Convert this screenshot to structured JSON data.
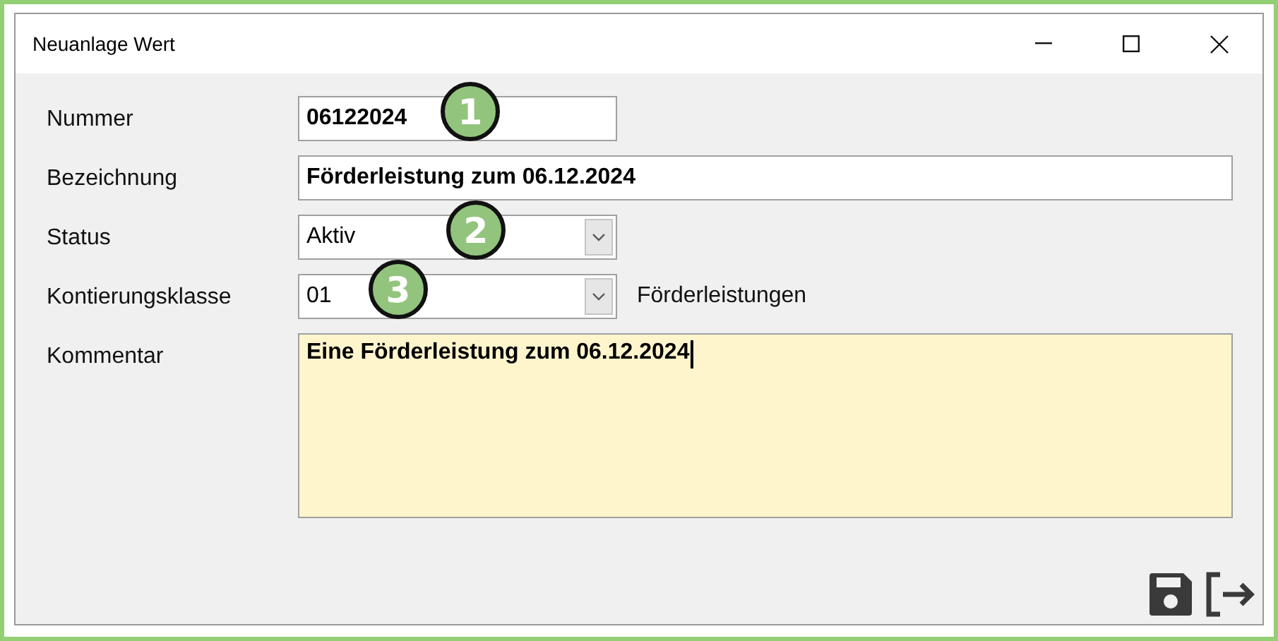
{
  "window": {
    "title": "Neuanlage Wert"
  },
  "fields": [
    {
      "kind": "text",
      "label": "Nummer",
      "value": "06122024",
      "badge": "1",
      "wide": false
    },
    {
      "kind": "text",
      "label": "Bezeichnung",
      "value": "Förderleistung zum 06.12.2024",
      "wide": true
    },
    {
      "kind": "combo",
      "label": "Status",
      "value": "Aktiv",
      "badge": "2"
    },
    {
      "kind": "combo",
      "label": "Kontierungsklasse",
      "value": "01",
      "badge": "3",
      "note": "Förderleistungen"
    },
    {
      "kind": "memo",
      "label": "Kommentar",
      "value": "Eine Förderleistung zum 06.12.2024",
      "focused": true
    }
  ]
}
